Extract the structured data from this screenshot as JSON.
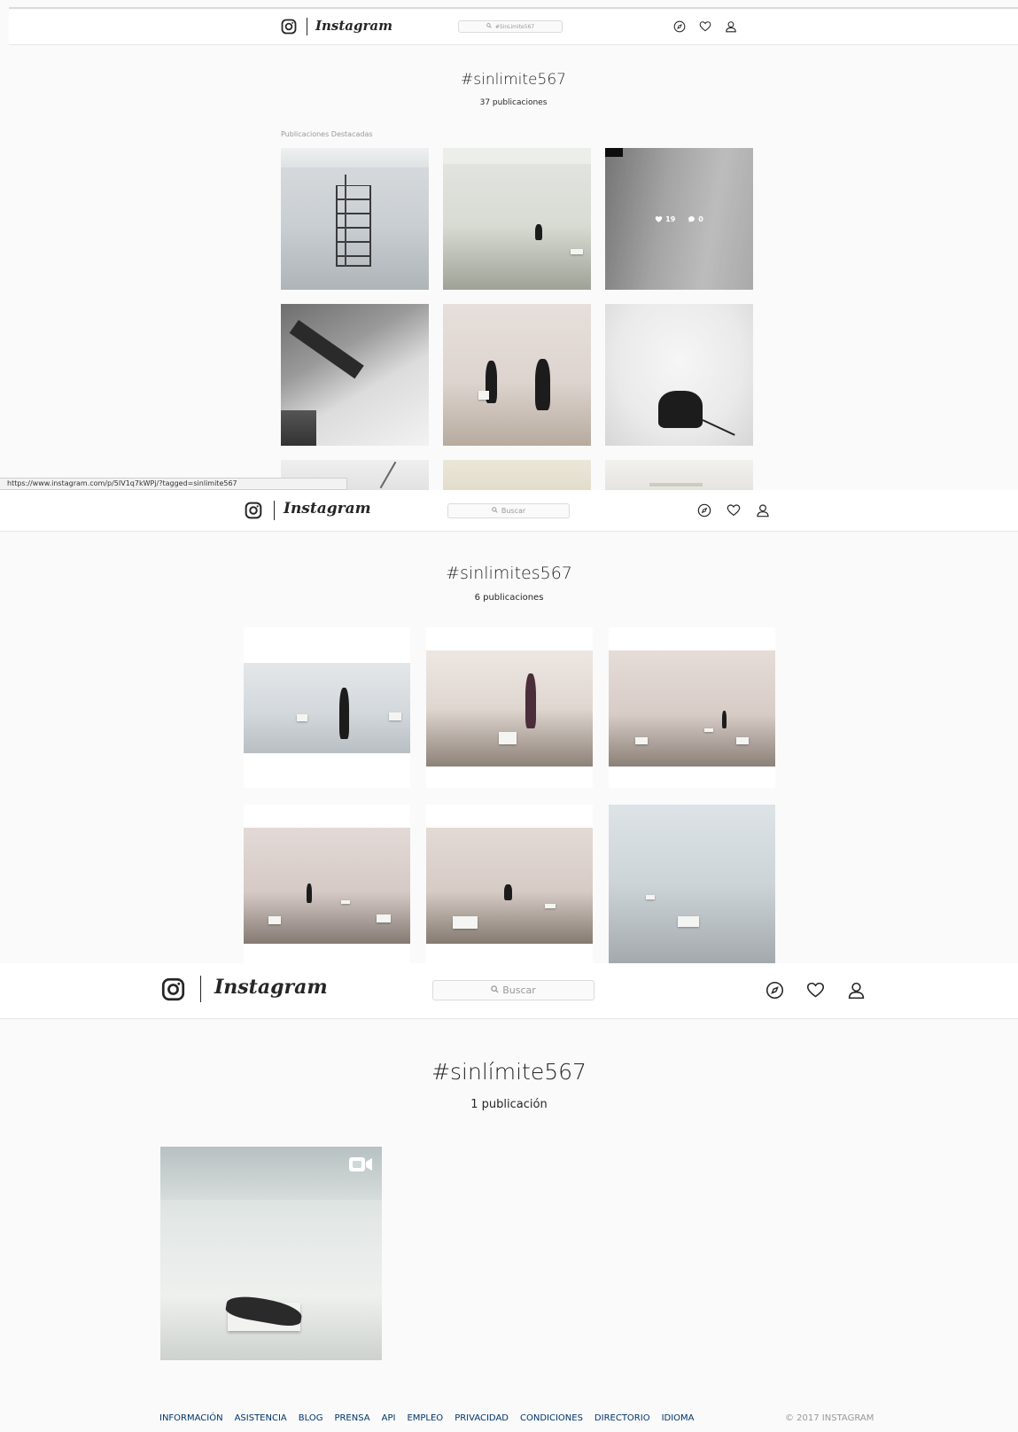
{
  "colors": {
    "background": "#fafafa",
    "nav_background": "#ffffff",
    "text": "#262626",
    "muted": "#999999",
    "footer_link": "#003569",
    "border": "#dbdbdb"
  },
  "screens": [
    {
      "brand": "Instagram",
      "search_text": "#SinLimite567",
      "nav_icons": [
        "compass-icon",
        "heart-icon",
        "user-icon"
      ],
      "tag": "#sinlimite567",
      "count": "37 publicaciones",
      "section_label": "Publicaciones Destacadas",
      "hover_post": {
        "likes": "19",
        "comments": "0"
      },
      "status_url": "https://www.instagram.com/p/5IV1q7kWPj/?tagged=sinlimite567"
    },
    {
      "brand": "Instagram",
      "search_text": "Buscar",
      "nav_icons": [
        "compass-icon",
        "heart-icon",
        "user-icon"
      ],
      "tag": "#sinlimites567",
      "count": "6 publicaciones"
    },
    {
      "brand": "Instagram",
      "search_text": "Buscar",
      "nav_icons": [
        "compass-icon",
        "heart-icon",
        "user-icon"
      ],
      "tag": "#sinlímite567",
      "count": "1 publicación",
      "video_badge": "video-camera-icon"
    }
  ],
  "footer": {
    "links": [
      "INFORMACIÓN",
      "ASISTENCIA",
      "BLOG",
      "PRENSA",
      "API",
      "EMPLEO",
      "PRIVACIDAD",
      "CONDICIONES",
      "DIRECTORIO",
      "IDIOMA"
    ],
    "copyright": "© 2017 INSTAGRAM"
  }
}
